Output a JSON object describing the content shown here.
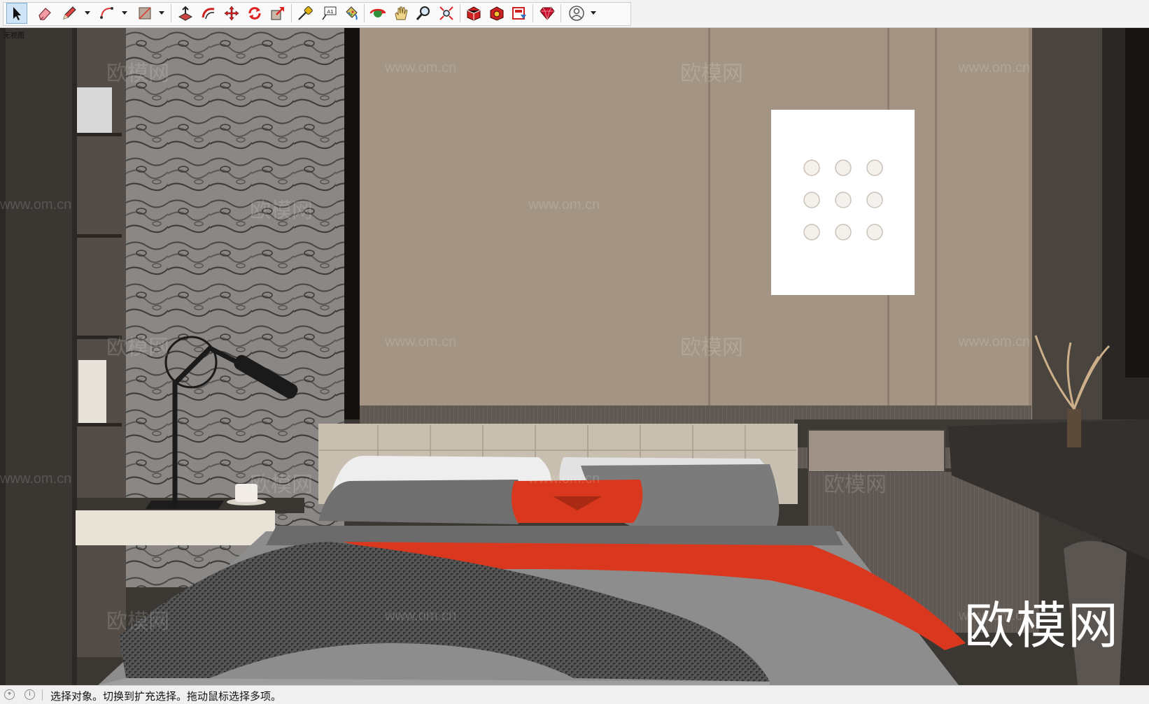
{
  "toolbar": {
    "tools": [
      {
        "name": "select-tool",
        "icon": "arrow-cursor-icon",
        "selected": true
      },
      {
        "name": "eraser-tool",
        "icon": "eraser-icon"
      },
      {
        "name": "line-tool",
        "icon": "pencil-icon",
        "dropdown": true
      },
      {
        "name": "arc-tool",
        "icon": "arc-icon",
        "dropdown": true
      },
      {
        "name": "rectangle-tool",
        "icon": "rectangle-icon",
        "dropdown": true
      },
      {
        "name": "push-pull-tool",
        "icon": "push-pull-icon"
      },
      {
        "name": "offset-tool",
        "icon": "offset-icon"
      },
      {
        "name": "move-tool",
        "icon": "move-icon"
      },
      {
        "name": "rotate-tool",
        "icon": "rotate-icon"
      },
      {
        "name": "scale-tool",
        "icon": "scale-icon"
      },
      {
        "name": "tape-measure-tool",
        "icon": "tape-measure-icon"
      },
      {
        "name": "text-tool",
        "icon": "text-icon"
      },
      {
        "name": "paint-bucket-tool",
        "icon": "paint-bucket-icon"
      },
      {
        "name": "orbit-tool",
        "icon": "orbit-icon"
      },
      {
        "name": "pan-tool",
        "icon": "hand-icon"
      },
      {
        "name": "zoom-tool",
        "icon": "magnifier-icon"
      },
      {
        "name": "zoom-extents-tool",
        "icon": "zoom-extents-icon"
      },
      {
        "name": "3d-warehouse-tool",
        "icon": "warehouse-icon"
      },
      {
        "name": "extension-warehouse-tool",
        "icon": "extension-icon"
      },
      {
        "name": "layout-tool",
        "icon": "layout-icon"
      },
      {
        "name": "ruby-console-tool",
        "icon": "ruby-icon"
      },
      {
        "name": "account-tool",
        "icon": "user-icon",
        "dropdown": true
      }
    ],
    "text_tool_glyph": "A1"
  },
  "viewport": {
    "label": "无视图",
    "watermark_url": "www.om.cn",
    "watermark_cn": "欧模网",
    "brand_logo": "欧模网"
  },
  "status": {
    "text": "选择对象。切换到扩充选择。拖动鼠标选择多项。",
    "icons": [
      "location-icon",
      "info-icon"
    ]
  }
}
